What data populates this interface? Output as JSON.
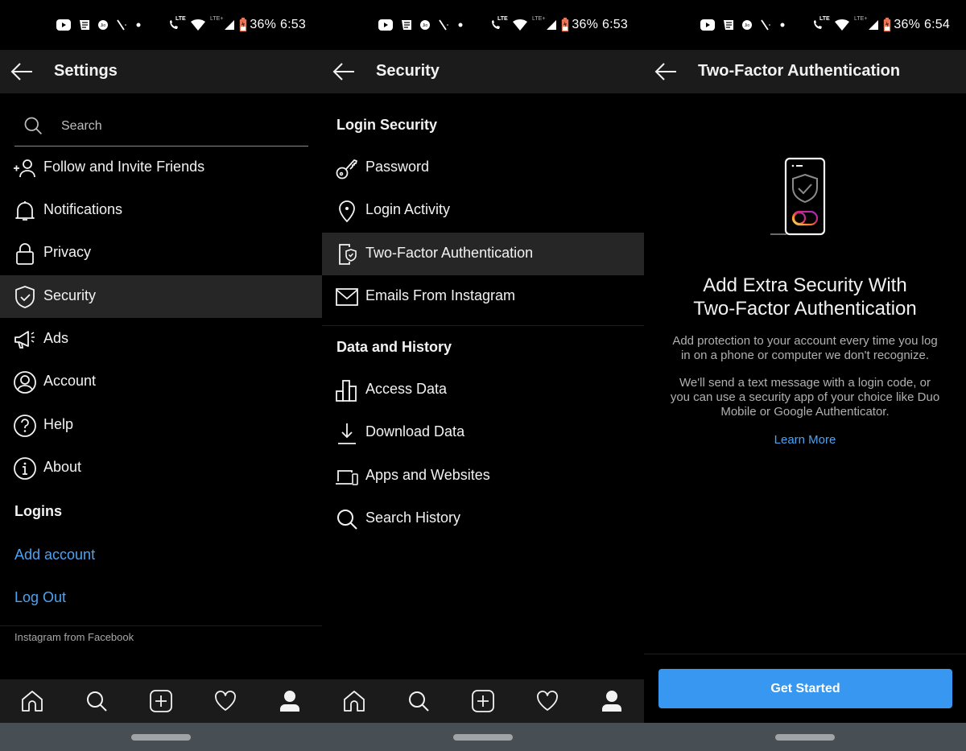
{
  "status_bars": [
    {
      "battery": "36%",
      "time": "6:53",
      "battery_color": "#e8775a"
    },
    {
      "battery": "36%",
      "time": "6:53",
      "battery_color": "#e8775a"
    },
    {
      "battery": "36%",
      "time": "6:54",
      "battery_color": "#e8775a"
    }
  ],
  "status_icons": [
    "youtube-icon",
    "news-icon",
    "jio-icon",
    "missed-call-icon",
    "dot-icon",
    "volte-call-icon",
    "wifi-icon",
    "lte-plus-icon",
    "signal-icon",
    "battery-icon"
  ],
  "status_labels": {
    "lte_call": "LTE",
    "lte_plus": "LTE+"
  },
  "settings": {
    "title": "Settings",
    "search_placeholder": "Search",
    "items": [
      {
        "label": "Follow and Invite Friends",
        "icon": "add-person-icon"
      },
      {
        "label": "Notifications",
        "icon": "bell-icon"
      },
      {
        "label": "Privacy",
        "icon": "lock-icon"
      },
      {
        "label": "Security",
        "icon": "shield-check-icon",
        "active": true
      },
      {
        "label": "Ads",
        "icon": "megaphone-icon"
      },
      {
        "label": "Account",
        "icon": "account-circle-icon"
      },
      {
        "label": "Help",
        "icon": "help-circle-icon"
      },
      {
        "label": "About",
        "icon": "info-circle-icon"
      }
    ],
    "logins_header": "Logins",
    "add_account": "Add account",
    "log_out": "Log Out",
    "footer": "Instagram from Facebook"
  },
  "security": {
    "title": "Security",
    "sections": [
      {
        "header": "Login Security",
        "items": [
          {
            "label": "Password",
            "icon": "key-icon"
          },
          {
            "label": "Login Activity",
            "icon": "location-pin-icon"
          },
          {
            "label": "Two-Factor Authentication",
            "icon": "phone-shield-icon",
            "active": true
          },
          {
            "label": "Emails From Instagram",
            "icon": "mail-icon"
          }
        ]
      },
      {
        "header": "Data and History",
        "items": [
          {
            "label": "Access Data",
            "icon": "bar-chart-icon"
          },
          {
            "label": "Download Data",
            "icon": "download-icon"
          },
          {
            "label": "Apps and Websites",
            "icon": "devices-icon"
          },
          {
            "label": "Search History",
            "icon": "search-icon"
          }
        ]
      }
    ]
  },
  "two_factor": {
    "title": "Two-Factor Authentication",
    "heading_line1": "Add Extra Security With",
    "heading_line2": "Two-Factor Authentication",
    "para1_line1": "Add protection to your account every time you log",
    "para1_line2": "in on a phone or computer we don't recognize.",
    "para2_line1": "We'll send a text message with a login code, or",
    "para2_line2": "you can use a security app of your choice like Duo",
    "para2_line3": "Mobile or Google Authenticator.",
    "learn_more": "Learn More",
    "cta": "Get Started",
    "cta_color": "#3897f0",
    "link_color": "#4da3f2"
  },
  "bottom_nav": [
    "home-icon",
    "search-icon",
    "new-post-icon",
    "activity-heart-icon",
    "profile-icon"
  ]
}
